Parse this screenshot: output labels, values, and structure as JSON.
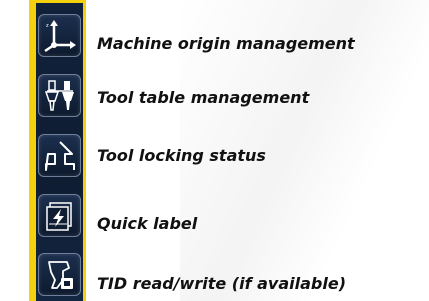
{
  "toolbar": {
    "items": [
      {
        "icon": "machine-origin-icon",
        "label": "Machine origin management"
      },
      {
        "icon": "tool-table-icon",
        "label": "Tool table management"
      },
      {
        "icon": "tool-locking-icon",
        "label": "Tool locking status"
      },
      {
        "icon": "quick-label-icon",
        "label": "Quick label"
      },
      {
        "icon": "tid-read-write-icon",
        "label": "TID read/write (if available)"
      }
    ]
  },
  "colors": {
    "toolbar_frame": "#f4d10d",
    "toolbar_bg": "#0f1d33",
    "icon_stroke": "#ffffff",
    "label_text": "#111111"
  }
}
